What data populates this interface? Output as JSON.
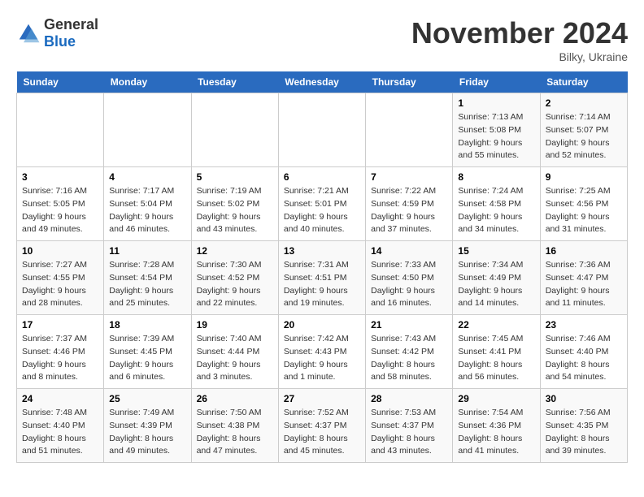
{
  "header": {
    "logo_general": "General",
    "logo_blue": "Blue",
    "month_title": "November 2024",
    "location": "Bilky, Ukraine"
  },
  "days_of_week": [
    "Sunday",
    "Monday",
    "Tuesday",
    "Wednesday",
    "Thursday",
    "Friday",
    "Saturday"
  ],
  "weeks": [
    {
      "days": [
        {
          "num": "",
          "info": ""
        },
        {
          "num": "",
          "info": ""
        },
        {
          "num": "",
          "info": ""
        },
        {
          "num": "",
          "info": ""
        },
        {
          "num": "",
          "info": ""
        },
        {
          "num": "1",
          "info": "Sunrise: 7:13 AM\nSunset: 5:08 PM\nDaylight: 9 hours and 55 minutes."
        },
        {
          "num": "2",
          "info": "Sunrise: 7:14 AM\nSunset: 5:07 PM\nDaylight: 9 hours and 52 minutes."
        }
      ]
    },
    {
      "days": [
        {
          "num": "3",
          "info": "Sunrise: 7:16 AM\nSunset: 5:05 PM\nDaylight: 9 hours and 49 minutes."
        },
        {
          "num": "4",
          "info": "Sunrise: 7:17 AM\nSunset: 5:04 PM\nDaylight: 9 hours and 46 minutes."
        },
        {
          "num": "5",
          "info": "Sunrise: 7:19 AM\nSunset: 5:02 PM\nDaylight: 9 hours and 43 minutes."
        },
        {
          "num": "6",
          "info": "Sunrise: 7:21 AM\nSunset: 5:01 PM\nDaylight: 9 hours and 40 minutes."
        },
        {
          "num": "7",
          "info": "Sunrise: 7:22 AM\nSunset: 4:59 PM\nDaylight: 9 hours and 37 minutes."
        },
        {
          "num": "8",
          "info": "Sunrise: 7:24 AM\nSunset: 4:58 PM\nDaylight: 9 hours and 34 minutes."
        },
        {
          "num": "9",
          "info": "Sunrise: 7:25 AM\nSunset: 4:56 PM\nDaylight: 9 hours and 31 minutes."
        }
      ]
    },
    {
      "days": [
        {
          "num": "10",
          "info": "Sunrise: 7:27 AM\nSunset: 4:55 PM\nDaylight: 9 hours and 28 minutes."
        },
        {
          "num": "11",
          "info": "Sunrise: 7:28 AM\nSunset: 4:54 PM\nDaylight: 9 hours and 25 minutes."
        },
        {
          "num": "12",
          "info": "Sunrise: 7:30 AM\nSunset: 4:52 PM\nDaylight: 9 hours and 22 minutes."
        },
        {
          "num": "13",
          "info": "Sunrise: 7:31 AM\nSunset: 4:51 PM\nDaylight: 9 hours and 19 minutes."
        },
        {
          "num": "14",
          "info": "Sunrise: 7:33 AM\nSunset: 4:50 PM\nDaylight: 9 hours and 16 minutes."
        },
        {
          "num": "15",
          "info": "Sunrise: 7:34 AM\nSunset: 4:49 PM\nDaylight: 9 hours and 14 minutes."
        },
        {
          "num": "16",
          "info": "Sunrise: 7:36 AM\nSunset: 4:47 PM\nDaylight: 9 hours and 11 minutes."
        }
      ]
    },
    {
      "days": [
        {
          "num": "17",
          "info": "Sunrise: 7:37 AM\nSunset: 4:46 PM\nDaylight: 9 hours and 8 minutes."
        },
        {
          "num": "18",
          "info": "Sunrise: 7:39 AM\nSunset: 4:45 PM\nDaylight: 9 hours and 6 minutes."
        },
        {
          "num": "19",
          "info": "Sunrise: 7:40 AM\nSunset: 4:44 PM\nDaylight: 9 hours and 3 minutes."
        },
        {
          "num": "20",
          "info": "Sunrise: 7:42 AM\nSunset: 4:43 PM\nDaylight: 9 hours and 1 minute."
        },
        {
          "num": "21",
          "info": "Sunrise: 7:43 AM\nSunset: 4:42 PM\nDaylight: 8 hours and 58 minutes."
        },
        {
          "num": "22",
          "info": "Sunrise: 7:45 AM\nSunset: 4:41 PM\nDaylight: 8 hours and 56 minutes."
        },
        {
          "num": "23",
          "info": "Sunrise: 7:46 AM\nSunset: 4:40 PM\nDaylight: 8 hours and 54 minutes."
        }
      ]
    },
    {
      "days": [
        {
          "num": "24",
          "info": "Sunrise: 7:48 AM\nSunset: 4:40 PM\nDaylight: 8 hours and 51 minutes."
        },
        {
          "num": "25",
          "info": "Sunrise: 7:49 AM\nSunset: 4:39 PM\nDaylight: 8 hours and 49 minutes."
        },
        {
          "num": "26",
          "info": "Sunrise: 7:50 AM\nSunset: 4:38 PM\nDaylight: 8 hours and 47 minutes."
        },
        {
          "num": "27",
          "info": "Sunrise: 7:52 AM\nSunset: 4:37 PM\nDaylight: 8 hours and 45 minutes."
        },
        {
          "num": "28",
          "info": "Sunrise: 7:53 AM\nSunset: 4:37 PM\nDaylight: 8 hours and 43 minutes."
        },
        {
          "num": "29",
          "info": "Sunrise: 7:54 AM\nSunset: 4:36 PM\nDaylight: 8 hours and 41 minutes."
        },
        {
          "num": "30",
          "info": "Sunrise: 7:56 AM\nSunset: 4:35 PM\nDaylight: 8 hours and 39 minutes."
        }
      ]
    }
  ]
}
